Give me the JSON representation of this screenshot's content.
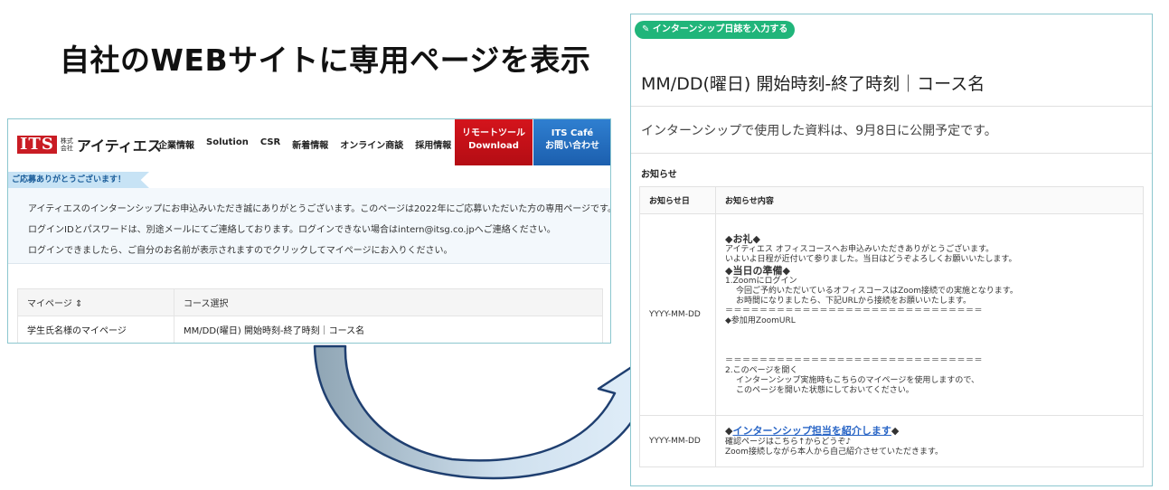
{
  "headline": "自社のWEBサイトに専用ページを表示",
  "left_panel": {
    "logo": {
      "mark": "ITS",
      "small": "株式会社",
      "text": "アイティエス"
    },
    "nav": [
      "企業情報",
      "Solution",
      "CSR",
      "新着情報",
      "オンライン商談",
      "採用情報"
    ],
    "remote_button": {
      "line1": "リモートツール",
      "line2": "Download"
    },
    "cafe_button": {
      "line1": "ITS Café",
      "line2": "お問い合わせ"
    },
    "thanks_ribbon": "ご応募ありがとうございます！",
    "notice_lines": [
      "アイティエスのインターンシップにお申込みいただき誠にありがとうございます。このページは2022年にご応募いただいた方の専用ページです。",
      "ログインIDとパスワードは、別途メールにてご連絡しております。ログインできない場合はintern@itsg.co.jpへご連絡ください。",
      "ログインできましたら、ご自分のお名前が表示されますのでクリックしてマイページにお入りください。"
    ],
    "table": {
      "headers": [
        "マイページ ⇕",
        "コース選択"
      ],
      "rows": [
        [
          "学生氏名様のマイページ",
          "MM/DD(曜日) 開始時刻-終了時刻｜コース名"
        ]
      ]
    }
  },
  "right_panel": {
    "diary_button": "✎ インターンシップ日誌を入力する",
    "slot_title": "MM/DD(曜日)  開始時刻-終了時刻｜コース名",
    "publish_note": "インターンシップで使用した資料は、9月8日に公開予定です。",
    "news_label": "お知らせ",
    "news_table": {
      "headers": [
        "お知らせ日",
        "お知らせ内容"
      ],
      "row1": {
        "date": "YYYY-MM-DD",
        "heading1": "◆お礼◆",
        "thanks1": "アイティエス オフィスコースへお申込みいただきありがとうございます。",
        "thanks2": "いよいよ日程が近付いて参りました。当日はどうぞよろしくお願いいたします。",
        "heading2": "◆当日の準備◆",
        "step1": "1.Zoomにログイン",
        "step1_a": "今回ご予約いただいているオフィスコースはZoom接続での実施となります。",
        "step1_b": "お時間になりましたら、下記URLから接続をお願いいたします。",
        "dashes": "＝＝＝＝＝＝＝＝＝＝＝＝＝＝＝＝＝＝＝＝＝＝＝＝＝＝＝＝＝＝",
        "zoom_url": "◆参加用ZoomURL",
        "step2": "2.このページを開く",
        "step2_a": "インターンシップ実施時もこちらのマイページを使用しますので、",
        "step2_b": "このページを開いた状態にしておいてください。"
      },
      "row2": {
        "date": "YYYY-MM-DD",
        "link_prefix": "◆",
        "link": "インターンシップ担当を紹介します",
        "link_suffix": "◆",
        "line1": "確認ページはこちら↑からどうぞ♪",
        "line2": "Zoom接続しながら本人から自己紹介させていただきます。"
      }
    }
  },
  "colors": {
    "panel_border": "#8cc7cf",
    "remote_red": "#c4111a",
    "cafe_blue": "#2470c2",
    "diary_green": "#20b57a",
    "arrow_fill": "#9fb3c1"
  }
}
